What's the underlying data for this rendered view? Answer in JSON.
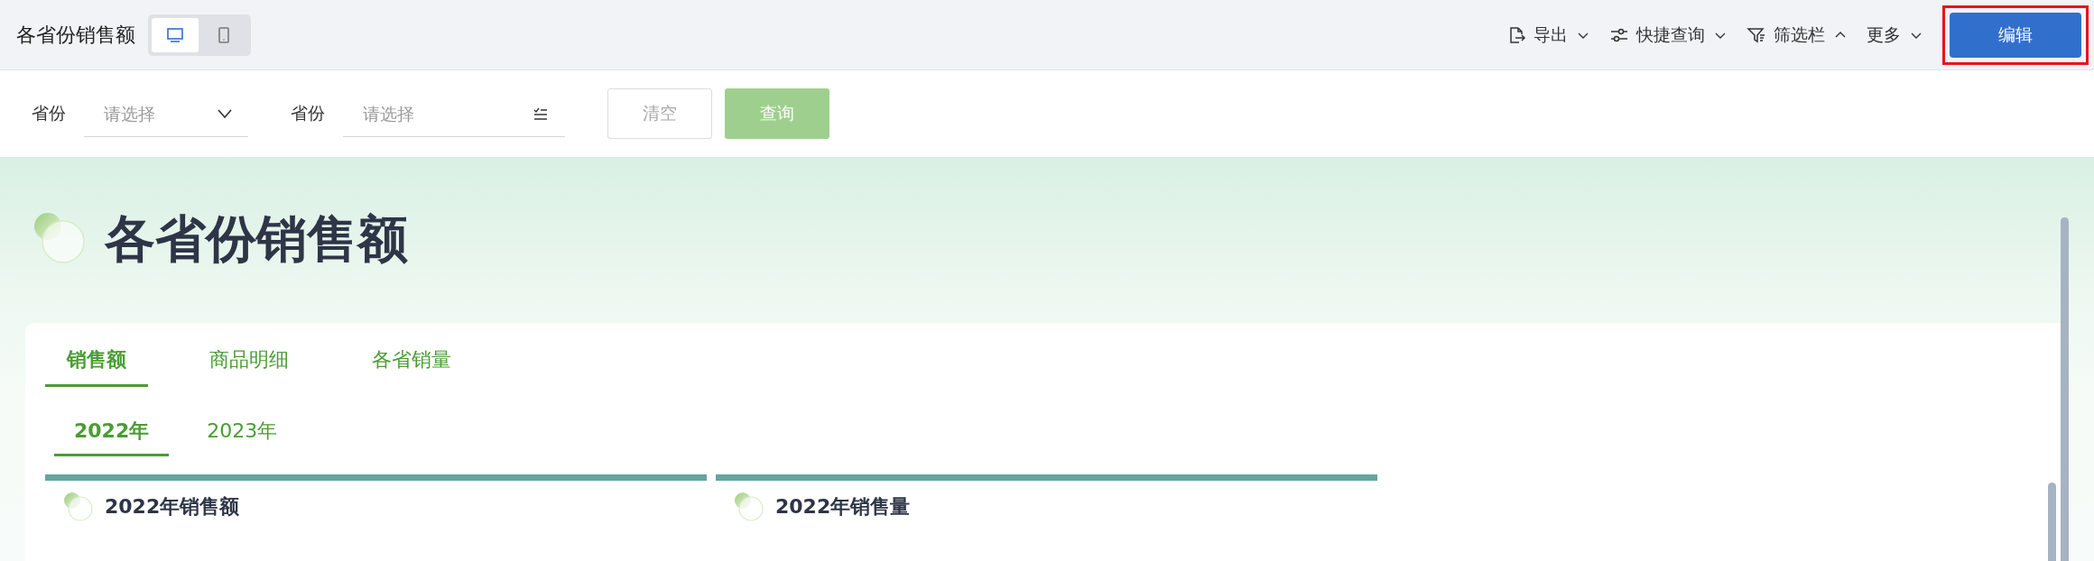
{
  "header": {
    "title": "各省份销售额",
    "view_modes": [
      {
        "kind": "desktop",
        "selected": true
      },
      {
        "kind": "mobile",
        "selected": false
      }
    ],
    "actions": [
      {
        "kind": "export",
        "label": "导出",
        "expanded": false
      },
      {
        "kind": "sliders",
        "label": "快捷查询",
        "expanded": false
      },
      {
        "kind": "filter",
        "label": "筛选栏",
        "expanded": true
      },
      {
        "kind": "none",
        "label": "更多",
        "expanded": false
      }
    ],
    "edit_button": {
      "label": "编辑",
      "highlighted": true
    }
  },
  "filters": [
    {
      "label": "省份",
      "placeholder": "请选择",
      "kind": "dropdown"
    },
    {
      "label": "省份",
      "placeholder": "请选择",
      "kind": "multi"
    }
  ],
  "filter_buttons": [
    {
      "label": "清空",
      "kind": "outline",
      "disabled": true
    },
    {
      "label": "查询",
      "kind": "primary",
      "disabled": true
    }
  ],
  "dashboard": {
    "title": "各省份销售额",
    "tabs": [
      {
        "label": "销售额",
        "selected": true
      },
      {
        "label": "商品明细",
        "selected": false
      },
      {
        "label": "各省销量",
        "selected": false
      }
    ],
    "year_tabs": [
      {
        "label": "2022年",
        "selected": true
      },
      {
        "label": "2023年",
        "selected": false
      }
    ],
    "panels": [
      {
        "title": "2022年销售额"
      },
      {
        "title": "2022年销售量"
      }
    ]
  }
}
